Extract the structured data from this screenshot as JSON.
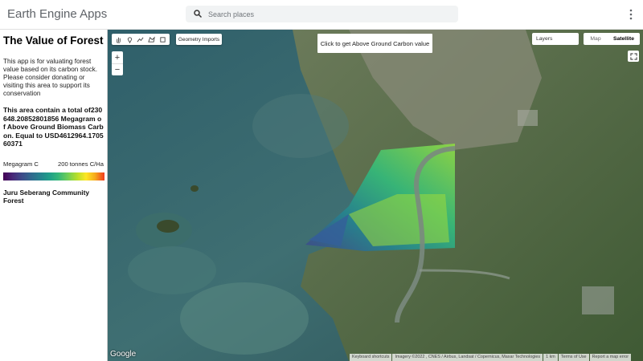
{
  "header": {
    "app_title": "Earth Engine Apps",
    "search_placeholder": "Search places"
  },
  "panel": {
    "title": "The Value of Forest",
    "description": "This app is for valuating forest value based on its carbon stock. Please consider donating or visiting this area to support its conservation",
    "total_text": "This area contain a total of230648.20852801856 Megagram of Above Ground Biomass Carbon. Equal to USD4612964.170560371",
    "legend_min": "Megagram C",
    "legend_max": "200 tonnes C/Ha",
    "forest_name": "Juru Seberang Community Forest"
  },
  "map": {
    "geometry_imports": "Geometry Imports",
    "click_label": "Click to get Above Ground Carbon value",
    "layers_label": "Layers",
    "map_label": "Map",
    "satellite_label": "Satellite",
    "zoom_in": "+",
    "zoom_out": "−",
    "google_label": "Google",
    "attributions": [
      "Keyboard shortcuts",
      "Imagery ©2022 , CNES / Airbus, Landsat / Copernicus, Maxar Technologies",
      "1 km",
      "Terms of Use",
      "Report a map error"
    ]
  },
  "icons": {
    "tools": [
      "hand-icon",
      "marker-icon",
      "line-icon",
      "shape-icon",
      "rectangle-icon"
    ]
  }
}
